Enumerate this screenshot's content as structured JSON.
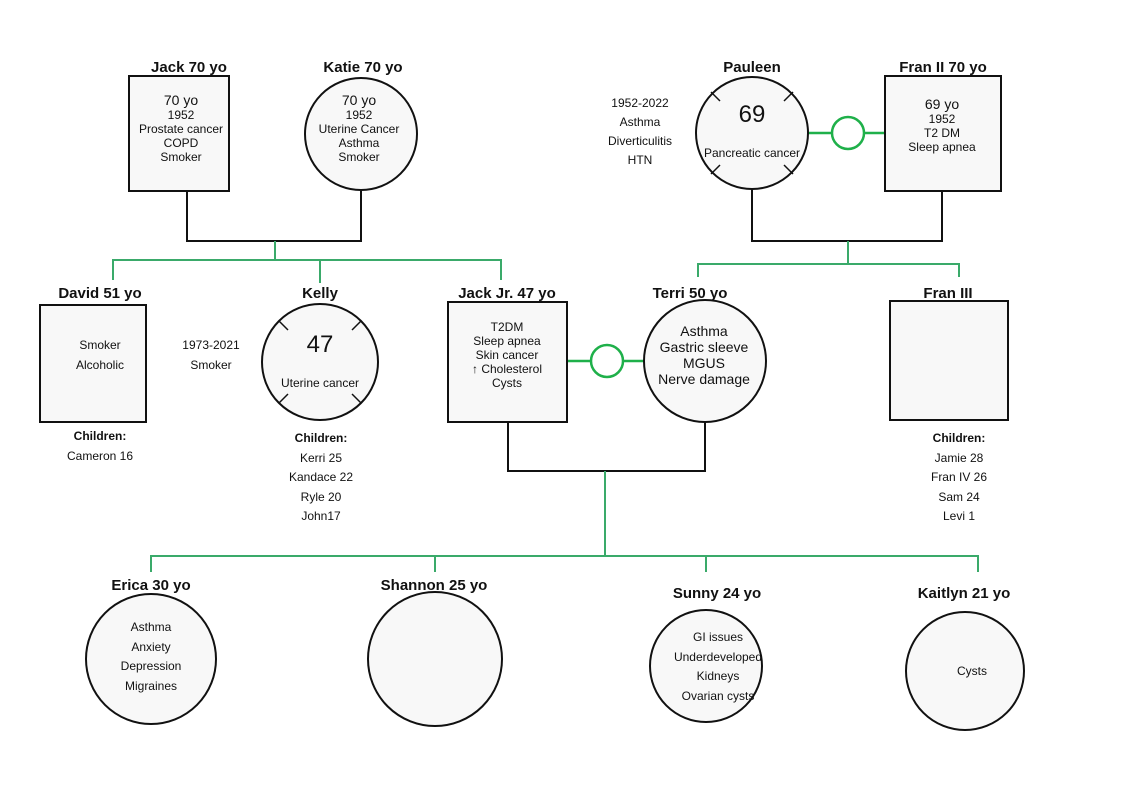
{
  "colors": {
    "line": "#111111",
    "descent": "#3aaa6a",
    "marriage": "#1fb04a",
    "fill": "#f8f8f8"
  },
  "people": {
    "jack": {
      "name": "Jack 70 yo",
      "age": "70 yo",
      "lines": [
        "1952",
        "Prostate cancer",
        "COPD",
        "Smoker"
      ]
    },
    "katie": {
      "name": "Katie 70 yo",
      "age": "70 yo",
      "lines": [
        "1952",
        "Uterine Cancer",
        "Asthma",
        "Smoker"
      ]
    },
    "pauleen": {
      "name": "Pauleen",
      "age_at_death": "69",
      "condition": "Pancreatic cancer",
      "side": [
        "1952-2022",
        "Asthma",
        "Diverticulitis",
        "HTN"
      ]
    },
    "fran2": {
      "name": "Fran II 70 yo",
      "age": "69 yo",
      "lines": [
        "1952",
        "T2 DM",
        "Sleep apnea"
      ]
    },
    "david": {
      "name": "David 51 yo",
      "lines": [
        "Smoker",
        "Alcoholic"
      ],
      "children_label": "Children:",
      "children": [
        "Cameron 16"
      ]
    },
    "kelly": {
      "name": "Kelly",
      "age_at_death": "47",
      "condition": "Uterine cancer",
      "side": [
        "1973-2021",
        "Smoker"
      ],
      "children_label": "Children:",
      "children": [
        "Kerri 25",
        "Kandace 22",
        "Ryle 20",
        "John17"
      ]
    },
    "jackjr": {
      "name": "Jack Jr. 47 yo",
      "lines": [
        "T2DM",
        "Sleep apnea",
        "Skin cancer",
        "↑ Cholesterol",
        "Cysts"
      ]
    },
    "terri": {
      "name": "Terri 50 yo",
      "lines": [
        "Asthma",
        "Gastric sleeve",
        "MGUS",
        "Nerve damage"
      ]
    },
    "fran3": {
      "name": "Fran III",
      "children_label": "Children:",
      "children": [
        "Jamie 28",
        "Fran IV 26",
        "Sam 24",
        "Levi 1"
      ]
    },
    "erica": {
      "name": "Erica 30 yo",
      "lines": [
        "Asthma",
        "Anxiety",
        "Depression",
        "Migraines"
      ]
    },
    "shannon": {
      "name": "Shannon 25 yo"
    },
    "sunny": {
      "name": "Sunny 24 yo",
      "lines": [
        "GI issues",
        "Underdeveloped",
        "Kidneys",
        "Ovarian cysts"
      ]
    },
    "kaitlyn": {
      "name": "Kaitlyn 21 yo",
      "lines": [
        "Cysts"
      ]
    }
  }
}
